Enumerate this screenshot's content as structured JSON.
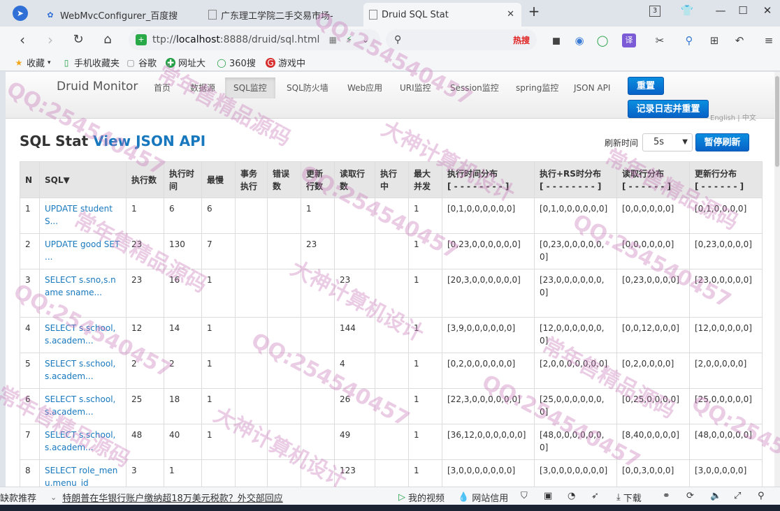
{
  "browser": {
    "tabs": [
      {
        "title": "WebMvcConfigurer_百度搜",
        "icon": "paw-icon"
      },
      {
        "title": "广东理工学院二手交易市场-",
        "icon": "page-icon"
      },
      {
        "title": "Druid SQL Stat",
        "icon": "page-icon",
        "active": true
      }
    ],
    "tab_count": "3",
    "url_prefix": "ttp://",
    "url_host": "localhost",
    "url_rest": ":8888/druid/sql.html",
    "search_hot": "热搜"
  },
  "bookmarks": [
    {
      "label": "收藏",
      "icon": "star-icon"
    },
    {
      "label": "手机收藏夹",
      "icon": "phone-icon"
    },
    {
      "label": "谷歌",
      "icon": "page-icon"
    },
    {
      "label": "网址大",
      "icon": "globe-icon"
    },
    {
      "label": "360搜",
      "icon": "search-360-icon"
    },
    {
      "label": "游戏中",
      "icon": "game-icon"
    }
  ],
  "druid": {
    "brand": "Druid Monitor",
    "nav": [
      "首页",
      "数据源",
      "SQL监控",
      "SQL防火墙",
      "Web应用",
      "URI监控",
      "Session监控",
      "spring监控",
      "JSON API"
    ],
    "reset_label": "重置",
    "log_reset_label": "记录日志并重置",
    "lang_label": "English | 中文",
    "title_plain": "SQL Stat",
    "title_link": "View JSON API",
    "refresh_label": "刷新时间",
    "refresh_value": "5s",
    "pause_label": "暂停刷新"
  },
  "table": {
    "headers": [
      "N",
      "SQL▼",
      "执行数",
      "执行时间",
      "最慢",
      "事务执行",
      "错误数",
      "更新行数",
      "读取行数",
      "执行中",
      "最大并发",
      "执行时间分布\n[ - - - - - - - - ]",
      "执行+RS时分布\n[ - - - - - - - - ]",
      "读取行分布\n[ - - - - - - ]",
      "更新行分布\n[ - - - - - - ]"
    ],
    "rows": [
      [
        "1",
        "UPDATE student S...",
        "1",
        "6",
        "6",
        "",
        "",
        "1",
        "",
        "",
        "1",
        "[0,1,0,0,0,0,0,0]",
        "[0,1,0,0,0,0,0,0]",
        "[0,0,0,0,0,0]",
        "[0,1,0,0,0,0]"
      ],
      [
        "2",
        "UPDATE good SET ...",
        "23",
        "130",
        "7",
        "",
        "",
        "23",
        "",
        "",
        "1",
        "[0,23,0,0,0,0,0,0]",
        "[0,23,0,0,0,0,0,0]",
        "[0,0,0,0,0,0]",
        "[0,23,0,0,0,0]"
      ],
      [
        "3",
        "SELECT s.sno,s.name sname...",
        "23",
        "16",
        "1",
        "",
        "",
        "",
        "23",
        "",
        "1",
        "[20,3,0,0,0,0,0,0]",
        "[23,0,0,0,0,0,0,0]",
        "[0,23,0,0,0,0]",
        "[23,0,0,0,0,0]"
      ],
      [
        "4",
        "SELECT s.school, s.academ...",
        "12",
        "14",
        "1",
        "",
        "",
        "",
        "144",
        "",
        "1",
        "[3,9,0,0,0,0,0,0]",
        "[12,0,0,0,0,0,0,0]",
        "[0,0,12,0,0,0]",
        "[12,0,0,0,0,0]"
      ],
      [
        "5",
        "SELECT s.school, s.academ...",
        "2",
        "2",
        "1",
        "",
        "",
        "",
        "4",
        "",
        "1",
        "[0,2,0,0,0,0,0,0]",
        "[2,0,0,0,0,0,0,0]",
        "[0,2,0,0,0,0]",
        "[2,0,0,0,0,0]"
      ],
      [
        "6",
        "SELECT s.school, s.academ...",
        "25",
        "18",
        "1",
        "",
        "",
        "",
        "26",
        "",
        "1",
        "[22,3,0,0,0,0,0,0]",
        "[25,0,0,0,0,0,0,0]",
        "[0,25,0,0,0,0]",
        "[25,0,0,0,0,0]"
      ],
      [
        "7",
        "SELECT s.school, s.academ...",
        "48",
        "40",
        "1",
        "",
        "",
        "",
        "49",
        "",
        "1",
        "[36,12,0,0,0,0,0,0]",
        "[48,0,0,0,0,0,0,0]",
        "[8,40,0,0,0,0]",
        "[48,0,0,0,0,0]"
      ],
      [
        "8",
        "SELECT role_menu.menu_id",
        "3",
        "1",
        "",
        "",
        "",
        "",
        "123",
        "",
        "1",
        "[3,0,0,0,0,0,0,0]",
        "[3,0,0,0,0,0,0,0]",
        "[0,0,3,0,0,0]",
        "[3,0,0,0,0,0]"
      ]
    ]
  },
  "statusbar": {
    "left": "缺款推荐",
    "news": "特朗普在华银行账户缴纳超18万美元税款？外交部回应",
    "video": "我的视频",
    "netbank": "网站信用",
    "download": "下载"
  },
  "watermark": [
    "QQ:254540457",
    "常年售精品源码",
    "大神计算机设计"
  ]
}
